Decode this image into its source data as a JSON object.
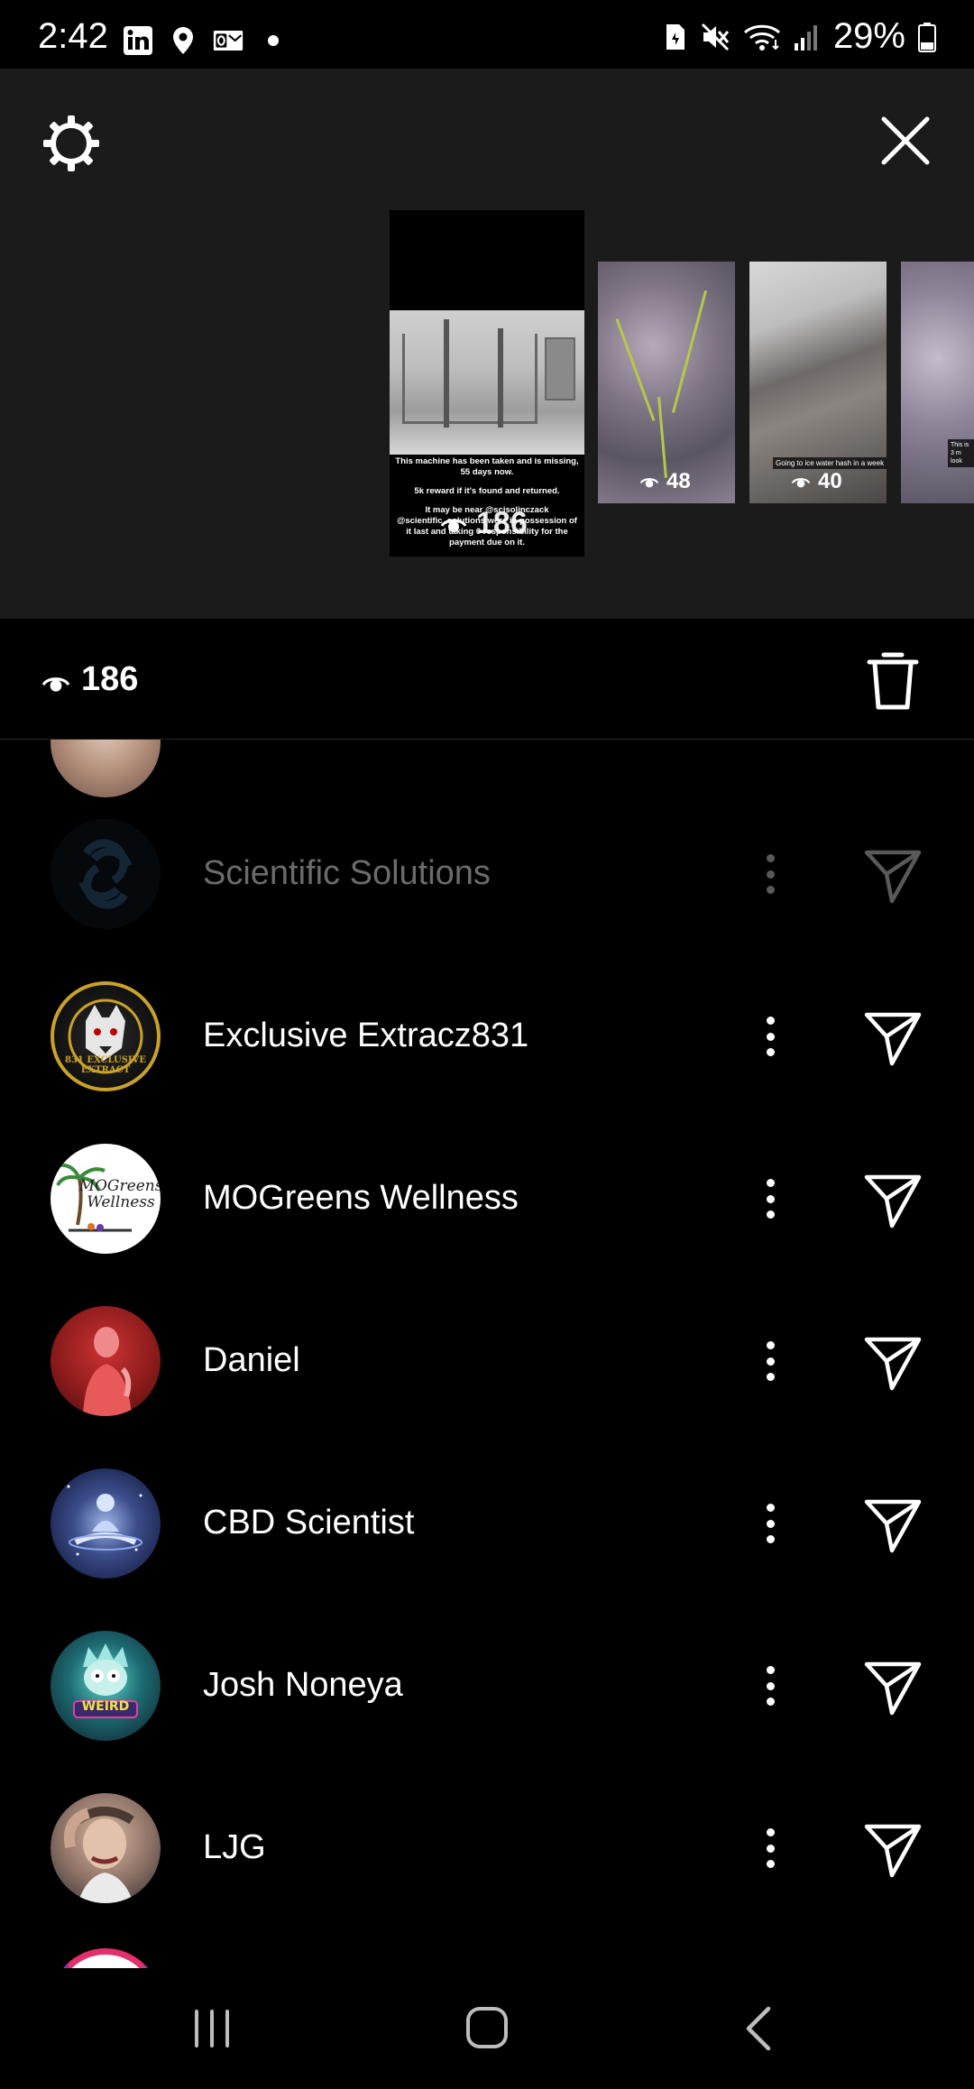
{
  "status_bar": {
    "time": "2:42",
    "battery": "29%",
    "left_icons": [
      "linkedin-icon",
      "location-icon",
      "outlook-icon",
      "dot-icon"
    ],
    "right_icons": [
      "sim-icon",
      "mute-icon",
      "wifi-icon",
      "signal-icon",
      "battery-icon"
    ]
  },
  "story_preview": {
    "main_thumb": {
      "caption_lines": [
        "This machine has been taken and is missing, 55 days now.",
        "5k reward if it's found and returned.",
        "It may be near @scisolinczack @scientific_solutions were in possession of it last and taking 0 responsibility for the payment due on it."
      ],
      "views": "186"
    },
    "thumbs": [
      {
        "views": "48",
        "caption": ""
      },
      {
        "views": "40",
        "caption": "Going to ice water hash in a week"
      },
      {
        "views": "",
        "caption": "This is 3 m look"
      }
    ]
  },
  "views_bar": {
    "count": "186"
  },
  "viewers": [
    {
      "name": "Scientific Solutions",
      "dimmed": true
    },
    {
      "name": "Exclusive Extracz831",
      "dimmed": false
    },
    {
      "name": "MOGreens Wellness",
      "dimmed": false
    },
    {
      "name": "Daniel",
      "dimmed": false
    },
    {
      "name": "CBD Scientist",
      "dimmed": false
    },
    {
      "name": "Josh Noneya",
      "dimmed": false
    },
    {
      "name": "LJG",
      "dimmed": false
    }
  ],
  "avatar_text": {
    "mogreens": "MOGreens Wellness",
    "extracz": "831 EXCLUSIVE EXTRACT",
    "josh": "WEIRD"
  },
  "colors": {
    "background": "#000000",
    "preview_bg": "#1b1b1b",
    "text": "#ffffff",
    "dim_text": "#6b6b6b"
  }
}
